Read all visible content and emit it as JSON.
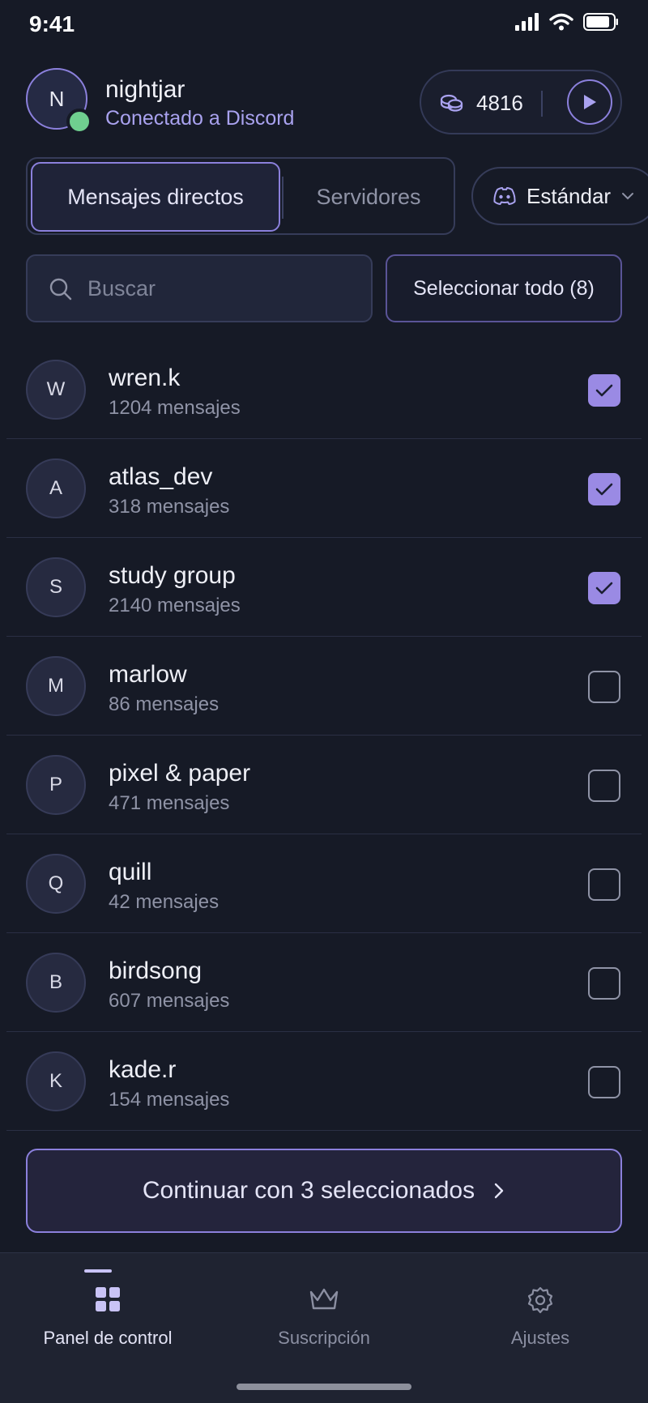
{
  "status_bar": {
    "time": "9:41"
  },
  "user": {
    "initial": "N",
    "name": "nightjar",
    "status": "Conectado a Discord"
  },
  "coins": {
    "value": "4816"
  },
  "tabs": [
    {
      "label": "Mensajes directos",
      "active": true
    },
    {
      "label": "Servidores",
      "active": false
    }
  ],
  "mode": {
    "label": "Estándar"
  },
  "search": {
    "placeholder": "Buscar"
  },
  "select_all": {
    "label": "Seleccionar todo (8)"
  },
  "conversations": [
    {
      "initial": "W",
      "name": "wren.k",
      "count": "1204 mensajes",
      "checked": true
    },
    {
      "initial": "A",
      "name": "atlas_dev",
      "count": "318 mensajes",
      "checked": true
    },
    {
      "initial": "S",
      "name": "study group",
      "count": "2140 mensajes",
      "checked": true
    },
    {
      "initial": "M",
      "name": "marlow",
      "count": "86 mensajes",
      "checked": false
    },
    {
      "initial": "P",
      "name": "pixel & paper",
      "count": "471 mensajes",
      "checked": false
    },
    {
      "initial": "Q",
      "name": "quill",
      "count": "42 mensajes",
      "checked": false
    },
    {
      "initial": "B",
      "name": "birdsong",
      "count": "607 mensajes",
      "checked": false
    },
    {
      "initial": "K",
      "name": "kade.r",
      "count": "154 mensajes",
      "checked": false
    }
  ],
  "continue_button": {
    "label": "Continuar con 3 seleccionados"
  },
  "bottom_nav": [
    {
      "label": "Panel de control",
      "icon": "grid-icon",
      "active": true
    },
    {
      "label": "Suscripción",
      "icon": "crown-icon",
      "active": false
    },
    {
      "label": "Ajustes",
      "icon": "gear-icon",
      "active": false
    }
  ],
  "colors": {
    "background": "#161a26",
    "accent": "#8b80dc",
    "checkbox_checked": "#9a8ae4",
    "online": "#6fcf8f"
  }
}
